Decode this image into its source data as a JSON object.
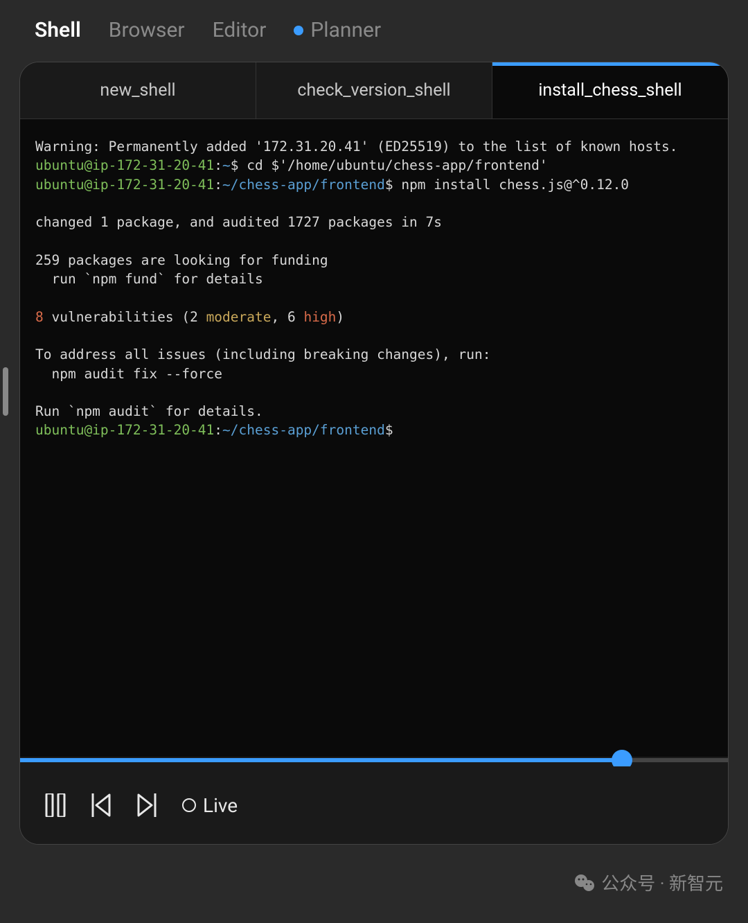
{
  "top_tabs": {
    "shell": "Shell",
    "browser": "Browser",
    "editor": "Editor",
    "planner": "Planner"
  },
  "panel": {
    "shell_tabs": [
      {
        "label": "new_shell",
        "active": false
      },
      {
        "label": "check_version_shell",
        "active": false
      },
      {
        "label": "install_chess_shell",
        "active": true
      }
    ]
  },
  "terminal": {
    "lines": [
      {
        "type": "plain",
        "text": "Warning: Permanently added '172.31.20.41' (ED25519) to the list of known hosts."
      },
      {
        "type": "prompt",
        "user": "ubuntu@ip-172-31-20-41",
        "sep": ":",
        "path": "~",
        "dollar": "$ ",
        "cmd": "cd $'/home/ubuntu/chess-app/frontend'"
      },
      {
        "type": "prompt",
        "user": "ubuntu@ip-172-31-20-41",
        "sep": ":",
        "path": "~/chess-app/frontend",
        "dollar": "$ ",
        "cmd": "npm install chess.js@^0.12.0"
      },
      {
        "type": "blank"
      },
      {
        "type": "plain",
        "text": "changed 1 package, and audited 1727 packages in 7s"
      },
      {
        "type": "blank"
      },
      {
        "type": "plain",
        "text": "259 packages are looking for funding"
      },
      {
        "type": "plain",
        "text": "  run `npm fund` for details"
      },
      {
        "type": "blank"
      },
      {
        "type": "vuln",
        "count": "8",
        "mid1": " vulnerabilities (2 ",
        "moderate": "moderate",
        "mid2": ", 6 ",
        "high": "high",
        "end": ")"
      },
      {
        "type": "blank"
      },
      {
        "type": "plain",
        "text": "To address all issues (including breaking changes), run:"
      },
      {
        "type": "plain",
        "text": "  npm audit fix --force"
      },
      {
        "type": "blank"
      },
      {
        "type": "plain",
        "text": "Run `npm audit` for details."
      },
      {
        "type": "prompt",
        "user": "ubuntu@ip-172-31-20-41",
        "sep": ":",
        "path": "~/chess-app/frontend",
        "dollar": "$",
        "cmd": ""
      }
    ]
  },
  "controls": {
    "live_label": "Live"
  },
  "watermark": {
    "text": "公众号 · 新智元"
  }
}
